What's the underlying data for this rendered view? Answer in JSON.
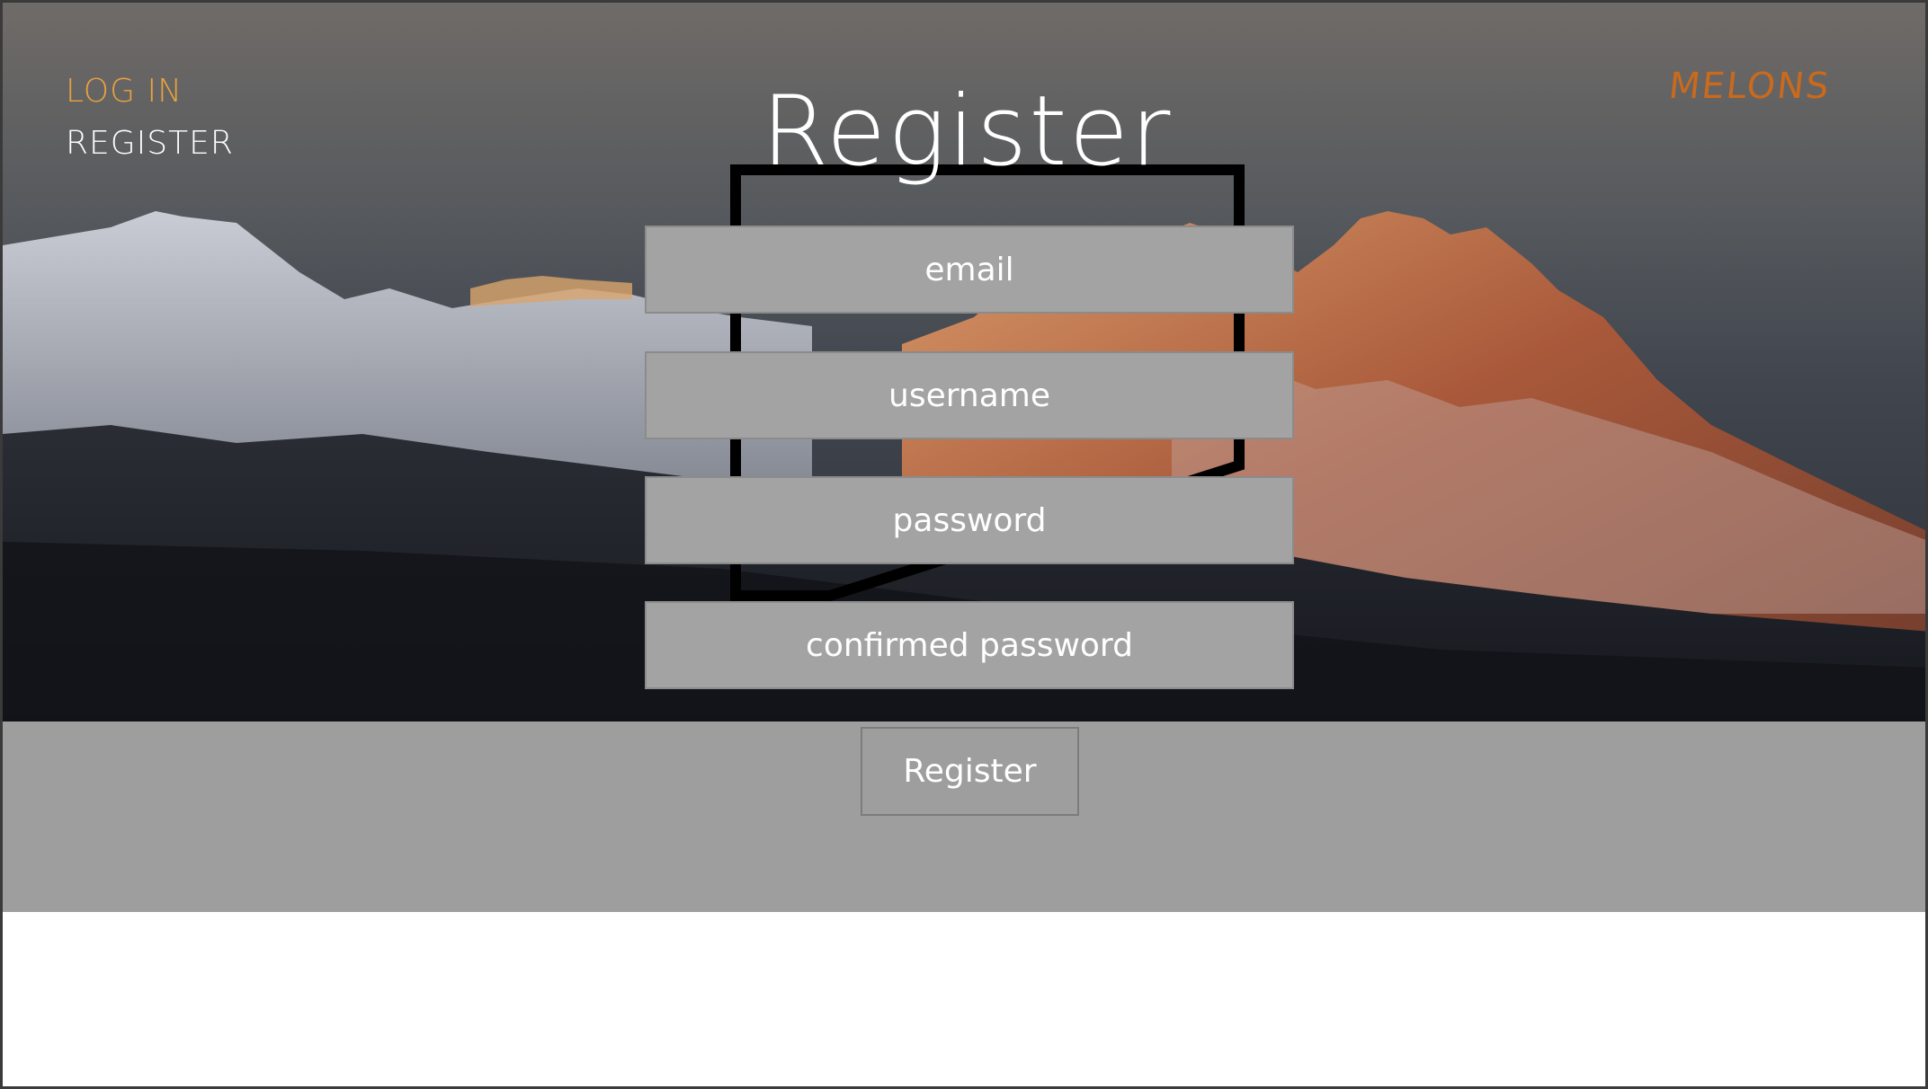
{
  "nav": {
    "login_label": "LOG IN",
    "register_label": "REGISTER"
  },
  "brand": {
    "name": "MELONS"
  },
  "form": {
    "title": "Register",
    "email_placeholder": "email",
    "username_placeholder": "username",
    "password_placeholder": "password",
    "confirm_placeholder": "confirmed password",
    "submit_label": "Register"
  },
  "colors": {
    "login_link": "#e7a23f",
    "register_link": "#ffffff",
    "brand": "#c96a1c",
    "field_bg": "#a3a3a3",
    "band_bg": "#9e9e9e"
  }
}
